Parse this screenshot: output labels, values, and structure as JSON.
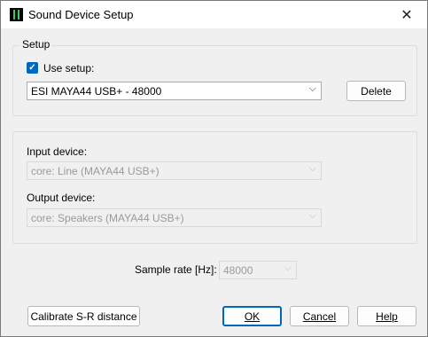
{
  "window": {
    "title": "Sound Device Setup",
    "close_glyph": "✕",
    "app_icon": "audio-meter-icon"
  },
  "setup_group": {
    "legend": "Setup",
    "use_setup_label": "Use setup:",
    "use_setup_checked": true,
    "selected_setup": "ESI MAYA44 USB+ - 48000",
    "delete_label": "Delete"
  },
  "devices_group": {
    "input_label": "Input device:",
    "input_value": "core: Line (MAYA44 USB+)",
    "output_label": "Output device:",
    "output_value": "core: Speakers (MAYA44 USB+)"
  },
  "sample_rate": {
    "label": "Sample rate [Hz]:",
    "value": "48000"
  },
  "footer": {
    "calibrate_label": "Calibrate S-R distance",
    "ok_label": "OK",
    "cancel_label": "Cancel",
    "help_label": "Help"
  },
  "colors": {
    "accent": "#0067c0",
    "disabled_text": "#9a9a9a"
  }
}
